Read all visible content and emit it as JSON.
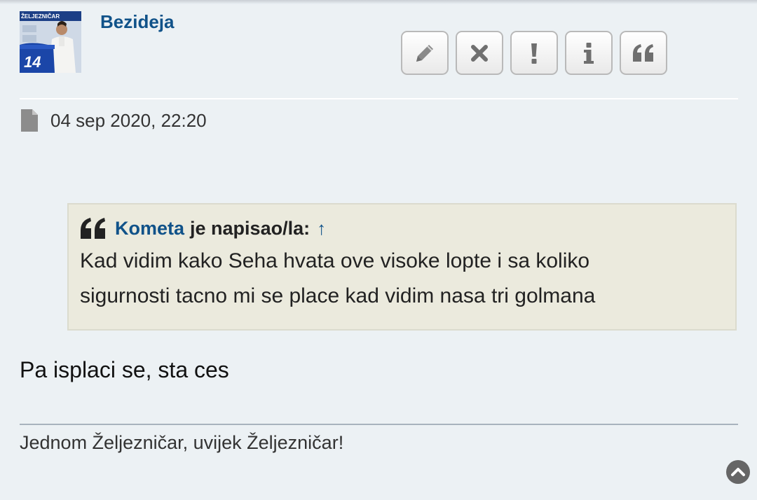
{
  "post": {
    "author": "Bezideja",
    "date": "04 sep 2020, 22:20",
    "body": "Pa isplaci se, sta ces",
    "signature": "Jednom Željezničar, uvijek Željezničar!"
  },
  "avatar": {
    "banner_text": "ŽELJEZNIČAR",
    "shirt_number": "14"
  },
  "actions": [
    {
      "name": "edit",
      "icon": "pencil-icon"
    },
    {
      "name": "delete",
      "icon": "close-icon"
    },
    {
      "name": "report",
      "icon": "exclamation-icon"
    },
    {
      "name": "info",
      "icon": "info-icon"
    },
    {
      "name": "quote",
      "icon": "quote-icon"
    }
  ],
  "quote": {
    "author": "Kometa",
    "wrote": "je napisao/la:",
    "jump": "↑",
    "text_line1": "Kad vidim kako Seha hvata ove visoke lopte i sa koliko",
    "text_line2": "sigurnosti tacno mi se place kad vidim nasa tri golmana"
  },
  "colors": {
    "link": "#105289",
    "quote_bg": "#ebeadd",
    "page_bg": "#ecf1f4"
  }
}
